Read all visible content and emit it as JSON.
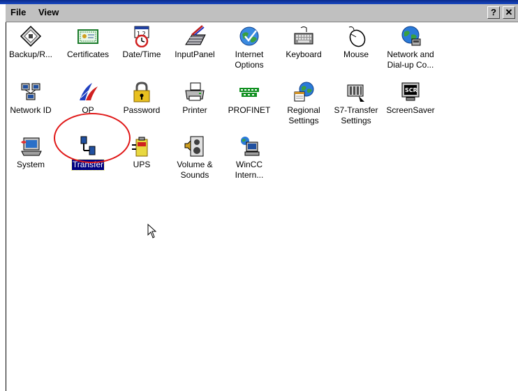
{
  "menu": {
    "file": "File",
    "view": "View",
    "help_btn": "?",
    "close_btn": "✕"
  },
  "items": [
    {
      "label": "Backup/R...",
      "icon": "backup-restore-icon"
    },
    {
      "label": "Certificates",
      "icon": "certificates-icon"
    },
    {
      "label": "Date/Time",
      "icon": "date-time-icon"
    },
    {
      "label": "InputPanel",
      "icon": "input-panel-icon"
    },
    {
      "label": "Internet\nOptions",
      "icon": "internet-options-icon"
    },
    {
      "label": "Keyboard",
      "icon": "keyboard-icon"
    },
    {
      "label": "Mouse",
      "icon": "mouse-icon"
    },
    {
      "label": "Network and\nDial-up Co...",
      "icon": "network-dialup-icon"
    },
    {
      "label": "Network ID",
      "icon": "network-id-icon"
    },
    {
      "label": "OP",
      "icon": "op-icon"
    },
    {
      "label": "Password",
      "icon": "password-icon"
    },
    {
      "label": "Printer",
      "icon": "printer-icon"
    },
    {
      "label": "PROFINET",
      "icon": "profinet-icon"
    },
    {
      "label": "Regional\nSettings",
      "icon": "regional-settings-icon"
    },
    {
      "label": "S7-Transfer\nSettings",
      "icon": "s7-transfer-icon"
    },
    {
      "label": "ScreenSaver",
      "icon": "screensaver-icon"
    },
    {
      "label": "System",
      "icon": "system-icon"
    },
    {
      "label": "Transfer",
      "icon": "transfer-icon",
      "selected": true
    },
    {
      "label": "UPS",
      "icon": "ups-icon"
    },
    {
      "label": "Volume &\nSounds",
      "icon": "volume-sounds-icon"
    },
    {
      "label": "WinCC\nIntern...",
      "icon": "wincc-internet-icon"
    }
  ],
  "colors": {
    "selection": "#000080",
    "highlight_circle": "#e01818",
    "menubar": "#c0c0c0"
  }
}
